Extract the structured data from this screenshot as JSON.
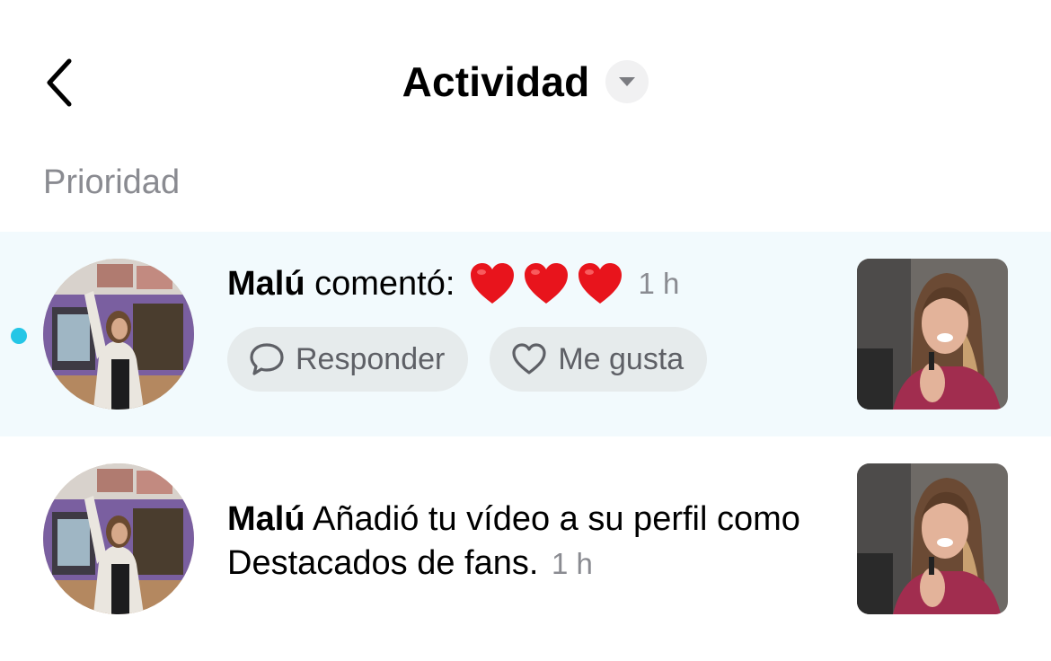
{
  "header": {
    "title": "Actividad"
  },
  "section": {
    "label": "Prioridad"
  },
  "notifications": [
    {
      "username": "Malú",
      "action": "comentó:",
      "comment_icons": [
        "heart-emoji",
        "heart-emoji",
        "heart-emoji"
      ],
      "time": "1 h",
      "unread": true,
      "reply_label": "Responder",
      "like_label": "Me gusta"
    },
    {
      "username": "Malú",
      "action": "Añadió tu vídeo a su perfil como Destacados de fans.",
      "time": "1 h",
      "unread": false
    }
  ],
  "colors": {
    "highlight_bg": "#f2fafd",
    "unread_dot": "#25c6e6",
    "heart": "#e8141c",
    "muted_text": "#8a8b91",
    "pill_bg": "#e6ebec"
  }
}
